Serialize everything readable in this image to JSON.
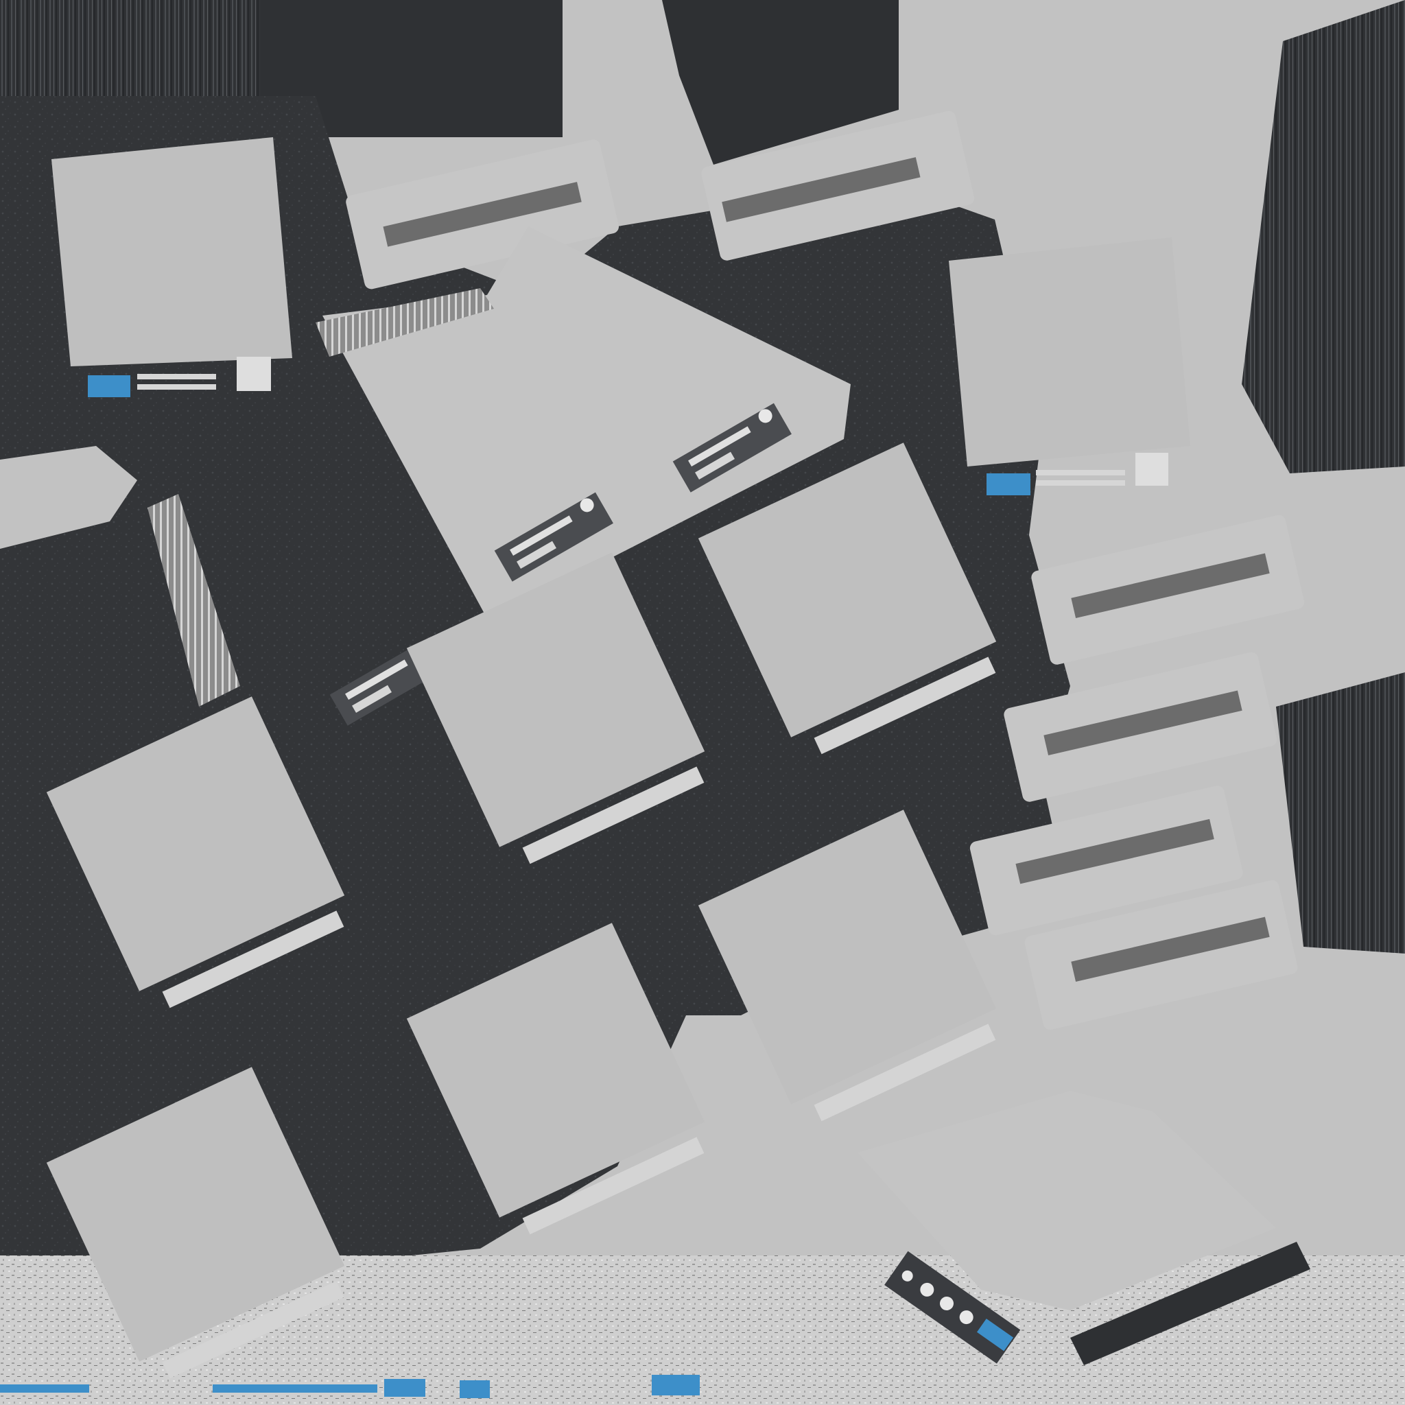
{
  "canvas": {
    "description_kind": "texture-atlas",
    "background_color": "#c2c2c2"
  },
  "palette": {
    "dark_panel": "#333538",
    "dark_panel_edge": "#2b2d30",
    "light_face": "#bfbfbf",
    "light_face_alt": "#c6c6c6",
    "slot_gray": "#6c6c6c",
    "accent_blue": "#3d8fc9",
    "led_white": "#e8e8e8",
    "speckle": "#4a4c50"
  },
  "counts": {
    "device_faces": 9,
    "cartridge_slots": 7,
    "blue_indicators": 5
  }
}
